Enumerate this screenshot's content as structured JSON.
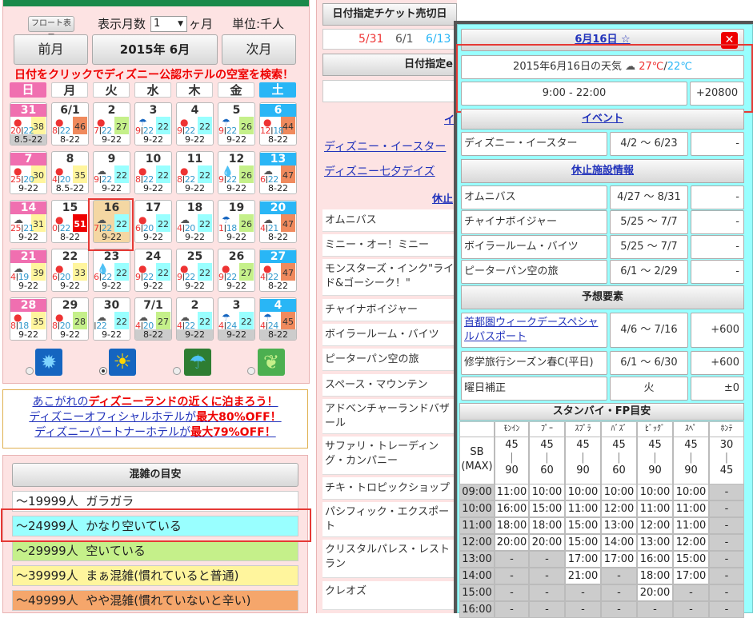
{
  "calendar": {
    "float_btn": "フロート表示",
    "months_label": "表示月数",
    "months_value": "1",
    "months_unit": "ヶ月",
    "unit": "単位:千人",
    "prev": "前月",
    "title": "2015年 6月",
    "next": "次月",
    "search_link": "日付をクリックでディズニー公認ホテルの空室を検索！",
    "weekdays": [
      "日",
      "月",
      "火",
      "水",
      "木",
      "金",
      "土"
    ],
    "weeks": [
      [
        {
          "d": "31",
          "wx": "sun",
          "t": [
            "20",
            "22"
          ],
          "v": "38",
          "c": "#fff59d",
          "h": "8.5-22",
          "hb": "#ccc",
          "dc": "#f06fb0"
        },
        {
          "d": "6/1",
          "wx": "sun",
          "t": [
            "8",
            "22"
          ],
          "v": "46",
          "c": "#f08a5d",
          "h": "8-22"
        },
        {
          "d": "2",
          "wx": "sun",
          "t": [
            "7",
            "22"
          ],
          "v": "27",
          "c": "#c5f08a",
          "h": "9-22"
        },
        {
          "d": "3",
          "wx": "rain",
          "t": [
            "9",
            "22"
          ],
          "v": "22",
          "c": "#9ff",
          "h": "9-22"
        },
        {
          "d": "4",
          "wx": "sun",
          "t": [
            "9",
            "22"
          ],
          "v": "22",
          "c": "#9ff",
          "h": "9-22"
        },
        {
          "d": "5",
          "wx": "rain",
          "t": [
            "9",
            "22"
          ],
          "v": "26",
          "c": "#c5f08a",
          "h": "9-22"
        },
        {
          "d": "6",
          "wx": "sun",
          "t": [
            "12",
            "18"
          ],
          "v": "44",
          "c": "#f08a5d",
          "h": "8-22",
          "dc": "#29b6f6"
        }
      ],
      [
        {
          "d": "7",
          "wx": "sun",
          "t": [
            "25",
            "20"
          ],
          "v": "30",
          "c": "#fff59d",
          "h": "9-22",
          "dc": "#f06fb0"
        },
        {
          "d": "8",
          "wx": "sun",
          "t": [
            "4",
            "20"
          ],
          "v": "35",
          "c": "#fff59d",
          "h": "8.5-22"
        },
        {
          "d": "9",
          "wx": "cloud",
          "t": [
            "9",
            "22"
          ],
          "v": "22",
          "c": "#9ff",
          "h": "9-22"
        },
        {
          "d": "10",
          "wx": "sun",
          "t": [
            "8",
            "22"
          ],
          "v": "22",
          "c": "#9ff",
          "h": "9-22"
        },
        {
          "d": "11",
          "wx": "sun",
          "t": [
            "8",
            "22"
          ],
          "v": "22",
          "c": "#9ff",
          "h": "9-22"
        },
        {
          "d": "12",
          "wx": "drop",
          "t": [
            "9",
            "22"
          ],
          "v": "26",
          "c": "#c5f08a",
          "h": "9-22"
        },
        {
          "d": "13",
          "wx": "cloud",
          "t": [
            "6",
            "22"
          ],
          "v": "47",
          "c": "#f08a5d",
          "h": "8-22",
          "dc": "#29b6f6"
        }
      ],
      [
        {
          "d": "14",
          "wx": "cloud",
          "t": [
            "25",
            "21"
          ],
          "v": "31",
          "c": "#fff59d",
          "h": "9-22",
          "dc": "#f06fb0"
        },
        {
          "d": "15",
          "wx": "sun",
          "t": [
            "0",
            "22"
          ],
          "v": "51",
          "c": "#e00",
          "h": "8-22",
          "vc": "#fff"
        },
        {
          "d": "16",
          "wx": "cloud",
          "t": [
            "7",
            "22"
          ],
          "v": "22",
          "c": "#9ff",
          "h": "9-22",
          "sel": true
        },
        {
          "d": "17",
          "wx": "sun",
          "t": [
            "6",
            "20"
          ],
          "v": "22",
          "c": "#9ff",
          "h": "9-22"
        },
        {
          "d": "18",
          "wx": "cloud",
          "t": [
            "4",
            "20"
          ],
          "v": "22",
          "c": "#9ff",
          "h": "9-22"
        },
        {
          "d": "19",
          "wx": "rain",
          "t": [
            "1",
            "18"
          ],
          "v": "26",
          "c": "#c5f08a",
          "h": "9-22"
        },
        {
          "d": "20",
          "wx": "cloud",
          "t": [
            "4",
            "21"
          ],
          "v": "47",
          "c": "#f08a5d",
          "h": "8-22",
          "dc": "#29b6f6"
        }
      ],
      [
        {
          "d": "21",
          "wx": "cloud",
          "t": [
            "4",
            "19"
          ],
          "v": "39",
          "c": "#fff59d",
          "h": "9-22",
          "dc": "#f06fb0"
        },
        {
          "d": "22",
          "wx": "sun",
          "t": [
            "6",
            "20"
          ],
          "v": "33",
          "c": "#fff59d",
          "h": "9-22"
        },
        {
          "d": "23",
          "wx": "drop",
          "t": [
            "6",
            "22"
          ],
          "v": "22",
          "c": "#9ff",
          "h": "9-22"
        },
        {
          "d": "24",
          "wx": "sun",
          "t": [
            "9",
            "22"
          ],
          "v": "22",
          "c": "#9ff",
          "h": "9-22"
        },
        {
          "d": "25",
          "wx": "sun",
          "t": [
            "9",
            "22"
          ],
          "v": "22",
          "c": "#9ff",
          "h": "9-22"
        },
        {
          "d": "26",
          "wx": "sun",
          "t": [
            "9",
            "22"
          ],
          "v": "27",
          "c": "#c5f08a",
          "h": "9-22"
        },
        {
          "d": "27",
          "wx": "sun",
          "t": [
            "4",
            "22"
          ],
          "v": "47",
          "c": "#f08a5d",
          "h": "8-22",
          "dc": "#29b6f6"
        }
      ],
      [
        {
          "d": "28",
          "wx": "sun",
          "t": [
            "8",
            "18"
          ],
          "v": "35",
          "c": "#fff59d",
          "h": "9-22",
          "dc": "#f06fb0"
        },
        {
          "d": "29",
          "wx": "sun",
          "t": [
            "8",
            "20"
          ],
          "v": "28",
          "c": "#c5f08a",
          "h": "9-22"
        },
        {
          "d": "30",
          "wx": "cloud",
          "t": [
            "",
            "22"
          ],
          "v": "22",
          "c": "#9ff",
          "h": "9-22"
        },
        {
          "d": "7/1",
          "wx": "cloud",
          "t": [
            "4",
            "20"
          ],
          "v": "27",
          "c": "#c5f08a",
          "h": "8-22",
          "hb": "#ccc"
        },
        {
          "d": "2",
          "wx": "cloud",
          "t": [
            "4",
            "22"
          ],
          "v": "22",
          "c": "#9ff",
          "h": "9-22",
          "hb": "#ccc"
        },
        {
          "d": "3",
          "wx": "rain",
          "t": [
            "4",
            "24"
          ],
          "v": "22",
          "c": "#9ff",
          "h": "9-22",
          "hb": "#ccc"
        },
        {
          "d": "4",
          "wx": "rain",
          "t": [
            "4",
            "24"
          ],
          "v": "45",
          "c": "#f08a5d",
          "h": "8-22",
          "hb": "#ccc",
          "dc": "#29b6f6"
        }
      ]
    ],
    "legend_icons": [
      "sun-ring-icon",
      "sun-icon",
      "umbrella-icon",
      "leaf-icon"
    ]
  },
  "promo": {
    "line1a": "あこがれの",
    "line1b": "ディズニーランド",
    "line1c": "の近くに泊まろう！",
    "line2a": "ディズニーオフィシャルホテル",
    "line2b": "が",
    "line2c": "最大80%OFF！",
    "line3a": "ディズニーパートナーホテル",
    "line3b": "が",
    "line3c": "最大79%OFF！"
  },
  "crowd": {
    "title": "混雑の目安",
    "levels": [
      {
        "range": "～19999人",
        "label": "ガラガラ",
        "color": "#fff"
      },
      {
        "range": "～24999人",
        "label": "かなり空いている",
        "color": "#9ff"
      },
      {
        "range": "～29999人",
        "label": "空いている",
        "color": "#c5f08a"
      },
      {
        "range": "～39999人",
        "label": "まぁ混雑(慣れていると普通)",
        "color": "#fff59d"
      },
      {
        "range": "～49999人",
        "label": "やや混雑(慣れていないと辛い)",
        "color": "#f5a66b"
      }
    ]
  },
  "middle": {
    "ticket_title": "日付指定チケット売切日",
    "ticket_dates": [
      "5/31",
      "6/1",
      "6/13"
    ],
    "ticket2_title": "日付指定e",
    "ev_partial": "イ",
    "events": [
      "ディズニー・イースター",
      "ディズニー七夕デイズ"
    ],
    "closed_partial": "休止",
    "rows": [
      "オムニバス",
      "ミニー・オー！ミニー",
      "モンスターズ・インク\"ライド&ゴーシーク！\"",
      "チャイナボイジャー",
      "ボイラールーム・バイツ",
      "ピーターパン空の旅",
      "スペース・マウンテン",
      "アドベンチャーランドバザール",
      "サファリ・トレーディング・カンパニー",
      "チキ・トロピックショップ",
      "パシフィック・エクスポート",
      "クリスタルパレス・レストラン",
      "クレオズ"
    ]
  },
  "popup": {
    "date": "6月16日 ☆",
    "weather_text": "2015年6月16日の天気",
    "temp_hi": "27℃",
    "sep": "/",
    "temp_lo": "22℃",
    "hours": "9:00 - 22:00",
    "delta": "+20800",
    "event_title": "イベント",
    "events": [
      {
        "name": "ディズニー・イースター",
        "period": "4/2 ～ 6/23",
        "val": "-"
      }
    ],
    "closed_title": "休止施設情報",
    "closed": [
      {
        "name": "オムニバス",
        "period": "4/27 ～ 8/31",
        "val": "-"
      },
      {
        "name": "チャイナボイジャー",
        "period": "5/25 ～ 7/7",
        "val": "-"
      },
      {
        "name": "ボイラールーム・バイツ",
        "period": "5/25 ～ 7/7",
        "val": "-"
      },
      {
        "name": "ピーターパン空の旅",
        "period": "6/1 ～ 2/29",
        "val": "-"
      }
    ],
    "factor_title": "予想要素",
    "factors": [
      {
        "name": "首都圏ウィークデースペシャルパスポート",
        "period": "4/6 ～ 7/16",
        "val": "+600",
        "link": true
      },
      {
        "name": "修学旅行シーズン春C(平日)",
        "period": "6/1 ～ 6/30",
        "val": "+600"
      },
      {
        "name": "曜日補正",
        "period": "火",
        "val": "±0"
      }
    ],
    "standby_title": "スタンバイ・FP目安",
    "cols": [
      "ﾓﾝｲﾝ",
      "ﾌﾟｰ",
      "ｽﾌﾟﾗ",
      "ﾊﾞｽﾞ",
      "ﾋﾞｯｸﾞ",
      "ｽﾍﾟ",
      "ﾎﾝﾃ"
    ],
    "sb_label": "SB\n(MAX)",
    "sb_top": [
      "45",
      "45",
      "45",
      "45",
      "45",
      "45",
      "30"
    ],
    "sb_bottom": [
      "90",
      "60",
      "90",
      "60",
      "90",
      "90",
      "45"
    ],
    "times": [
      "09:00",
      "10:00",
      "11:00",
      "12:00",
      "13:00",
      "14:00",
      "15:00",
      "16:00"
    ],
    "grid": [
      [
        "11:00",
        "10:00",
        "10:00",
        "10:00",
        "10:00",
        "10:00",
        "-"
      ],
      [
        "16:00",
        "15:00",
        "11:00",
        "12:00",
        "11:00",
        "11:00",
        "-"
      ],
      [
        "18:00",
        "18:00",
        "15:00",
        "13:00",
        "12:00",
        "11:00",
        "-"
      ],
      [
        "20:00",
        "20:00",
        "15:00",
        "14:00",
        "13:00",
        "12:00",
        "-"
      ],
      [
        "-",
        "-",
        "17:00",
        "17:00",
        "16:00",
        "15:00",
        "-"
      ],
      [
        "-",
        "-",
        "21:00",
        "-",
        "18:00",
        "17:00",
        "-"
      ],
      [
        "-",
        "-",
        "-",
        "-",
        "20:00",
        "-",
        "-"
      ],
      [
        "-",
        "-",
        "-",
        "-",
        "-",
        "-",
        "-"
      ]
    ]
  }
}
